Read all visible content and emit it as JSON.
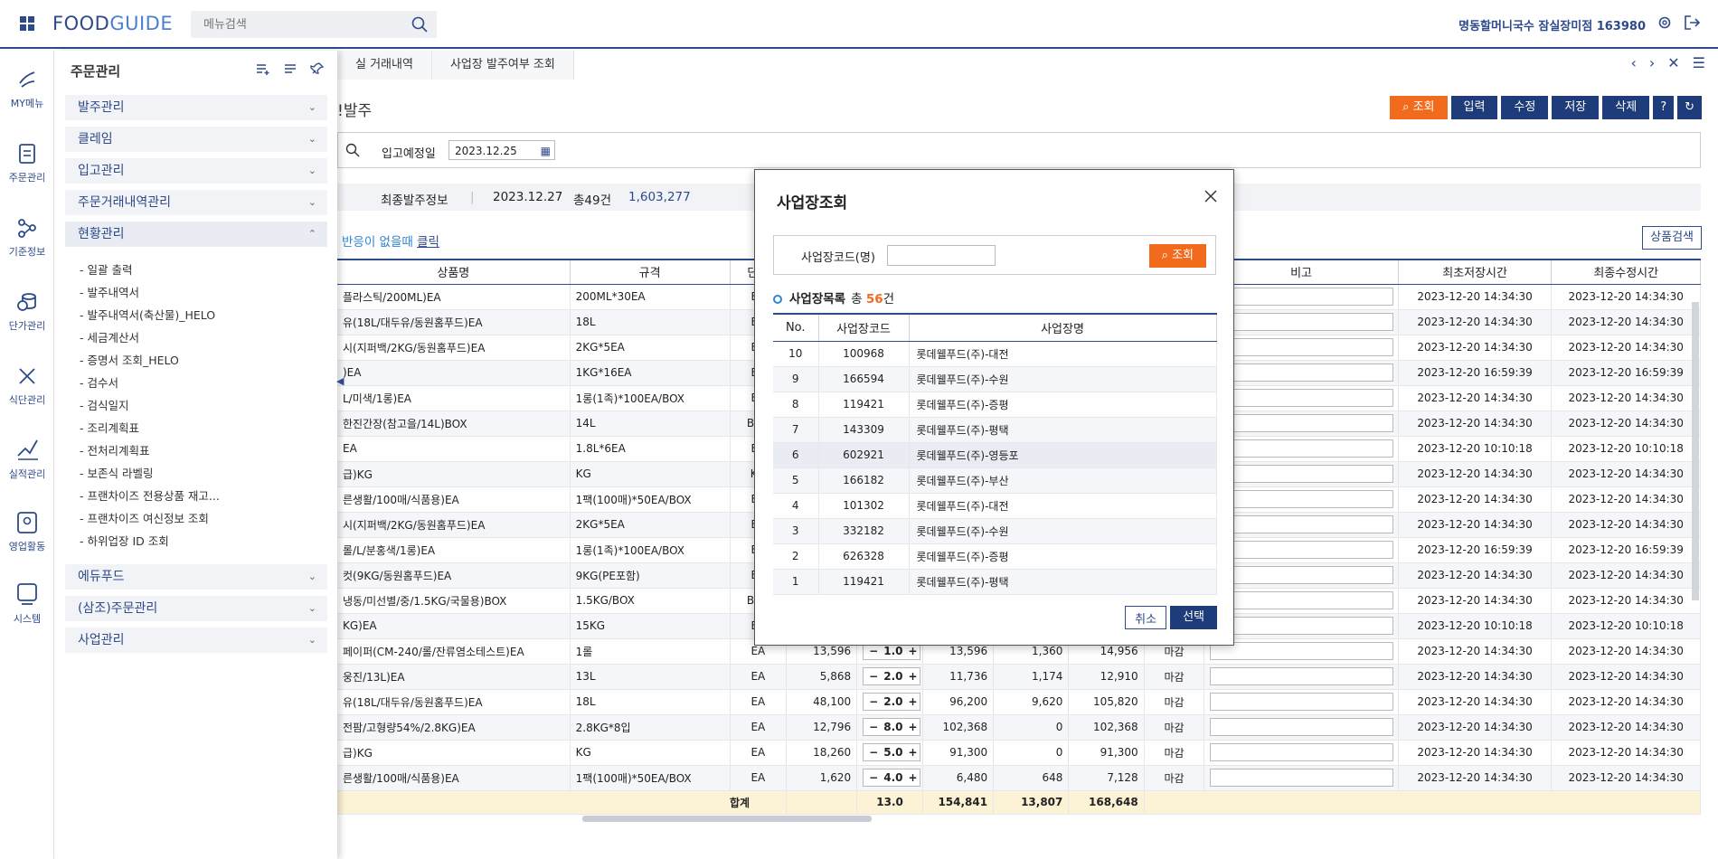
{
  "app": {
    "brand_food": "FOOD",
    "brand_guide": "GUIDE",
    "search_placeholder": "메뉴검색",
    "user": "명동할머니국수 잠실장미점 163980"
  },
  "rail": [
    {
      "label": "MY메뉴",
      "icon": "heart-hands-icon"
    },
    {
      "label": "주문관리",
      "icon": "order-document-icon"
    },
    {
      "label": "기준정보",
      "icon": "share-nodes-icon"
    },
    {
      "label": "단가관리",
      "icon": "coins-icon"
    },
    {
      "label": "식단관리",
      "icon": "utensils-icon"
    },
    {
      "label": "실적관리",
      "icon": "chart-icon"
    },
    {
      "label": "영업활동",
      "icon": "person-badge-icon"
    },
    {
      "label": "시스템",
      "icon": "system-monitor-icon"
    }
  ],
  "sidebar": {
    "title": "주문관리",
    "sections": [
      "발주관리",
      "클레임",
      "입고관리",
      "주문거래내역관리",
      "현황관리"
    ],
    "sub_items": [
      "- 일괄 출력",
      "- 발주내역서",
      "- 발주내역서(축산물)_HELO",
      "- 세금계산서",
      "- 증명서 조회_HELO",
      "- 검수서",
      "- 검식일지",
      "- 조리계획표",
      "- 전처리계획표",
      "- 보존식 라벨링",
      "- 프랜차이즈 전용상품 재고...",
      "- 프랜차이즈 여신정보 조회",
      "- 하위업장 ID 조회"
    ],
    "bottom_sections": [
      "에듀푸드",
      "(삼조)주문관리",
      "사업관리"
    ]
  },
  "tabs": [
    "실 거래내역",
    "사업장 발주여부 조회"
  ],
  "page": {
    "title": "!발주"
  },
  "toolbar": {
    "search": "조회",
    "input": "입력",
    "edit": "수정",
    "save": "저장",
    "delete": "삭제",
    "help": "?"
  },
  "filter": {
    "label": "입고예정일",
    "date": "2023.12.25"
  },
  "info": {
    "label": "최종발주정보",
    "date": "2023.12.27",
    "count": "총49건",
    "amount": "1,603,277"
  },
  "hint": {
    "text": "반응이 없을때 ",
    "link": "클릭"
  },
  "product_search": "상품검색",
  "grid": {
    "headers": [
      "상품명",
      "규격",
      "단위",
      "",
      "",
      "",
      "",
      "",
      "",
      "비고",
      "최초저장시간",
      "최종수정시간"
    ],
    "rows": [
      {
        "name": "플라스틱/200ML)EA",
        "spec": "200ML*30EA",
        "unit": "EA",
        "created": "2023-12-20 14:34:30",
        "modified": "2023-12-20 14:34:30"
      },
      {
        "name": "유(18L/대두유/동원홈푸드)EA",
        "spec": "18L",
        "unit": "EA",
        "created": "2023-12-20 14:34:30",
        "modified": "2023-12-20 14:34:30"
      },
      {
        "name": "시(지퍼백/2KG/동원홈푸드)EA",
        "spec": "2KG*5EA",
        "unit": "EA",
        "created": "2023-12-20 14:34:30",
        "modified": "2023-12-20 14:34:30"
      },
      {
        "name": ")EA",
        "spec": "1KG*16EA",
        "unit": "EA",
        "created": "2023-12-20 16:59:39",
        "modified": "2023-12-20 16:59:39"
      },
      {
        "name": "L/미색/1롱)EA",
        "spec": "1롱(1족)*100EA/BOX",
        "unit": "EA",
        "created": "2023-12-20 14:34:30",
        "modified": "2023-12-20 14:34:30"
      },
      {
        "name": "한진간장(참고을/14L)BOX",
        "spec": "14L",
        "unit": "BOX",
        "created": "2023-12-20 14:34:30",
        "modified": "2023-12-20 14:34:30"
      },
      {
        "name": "EA",
        "spec": "1.8L*6EA",
        "unit": "EA",
        "created": "2023-12-20 10:10:18",
        "modified": "2023-12-20 10:10:18"
      },
      {
        "name": "급)KG",
        "spec": "KG",
        "unit": "KG",
        "created": "2023-12-20 14:34:30",
        "modified": "2023-12-20 14:34:30"
      },
      {
        "name": "른생활/100매/식품용)EA",
        "spec": "1팩(100매)*50EA/BOX",
        "unit": "EA",
        "created": "2023-12-20 14:34:30",
        "modified": "2023-12-20 14:34:30"
      },
      {
        "name": "시(지퍼백/2KG/동원홈푸드)EA",
        "spec": "2KG*5EA",
        "unit": "EA",
        "created": "2023-12-20 14:34:30",
        "modified": "2023-12-20 14:34:30"
      },
      {
        "name": "롤/L/분홍색/1롱)EA",
        "spec": "1롱(1족)*100EA/BOX",
        "unit": "EA",
        "created": "2023-12-20 16:59:39",
        "modified": "2023-12-20 16:59:39"
      },
      {
        "name": "컷(9KG/동원홈푸드)EA",
        "spec": "9KG(PE포함)",
        "unit": "EA",
        "created": "2023-12-20 14:34:30",
        "modified": "2023-12-20 14:34:30"
      },
      {
        "name": "냉동/미선별/중/1.5KG/국물용)BOX",
        "spec": "1.5KG/BOX",
        "unit": "BOX",
        "created": "2023-12-20 14:34:30",
        "modified": "2023-12-20 14:34:30"
      },
      {
        "name": "KG)EA",
        "spec": "15KG",
        "unit": "EA",
        "created": "2023-12-20 10:10:18",
        "modified": "2023-12-20 10:10:18"
      },
      {
        "name": "페이퍼(CM-240/롤/잔류염소테스트)EA",
        "spec": "1롤",
        "unit": "EA",
        "price": "13,596",
        "qty": "1.0",
        "amount": "13,596",
        "vat": "1,360",
        "total": "14,956",
        "status": "마감",
        "created": "2023-12-20 14:34:30",
        "modified": "2023-12-20 14:34:30"
      },
      {
        "name": "웅진/13L)EA",
        "spec": "13L",
        "unit": "EA",
        "price": "5,868",
        "qty": "2.0",
        "amount": "11,736",
        "vat": "1,174",
        "total": "12,910",
        "status": "마감",
        "created": "2023-12-20 14:34:30",
        "modified": "2023-12-20 14:34:30"
      },
      {
        "name": "유(18L/대두유/동원홈푸드)EA",
        "spec": "18L",
        "unit": "EA",
        "price": "48,100",
        "qty": "2.0",
        "amount": "96,200",
        "vat": "9,620",
        "total": "105,820",
        "status": "마감",
        "created": "2023-12-20 14:34:30",
        "modified": "2023-12-20 14:34:30"
      },
      {
        "name": "전팜/고형량54%/2.8KG)EA",
        "spec": "2.8KG*8입",
        "unit": "EA",
        "price": "12,796",
        "qty": "8.0",
        "amount": "102,368",
        "vat": "0",
        "total": "102,368",
        "status": "마감",
        "created": "2023-12-20 14:34:30",
        "modified": "2023-12-20 14:34:30"
      },
      {
        "name": "급)KG",
        "spec": "KG",
        "unit": "EA",
        "price": "18,260",
        "qty": "5.0",
        "amount": "91,300",
        "vat": "0",
        "total": "91,300",
        "status": "마감",
        "created": "2023-12-20 14:34:30",
        "modified": "2023-12-20 14:34:30"
      },
      {
        "name": "른생활/100매/식품용)EA",
        "spec": "1팩(100매)*50EA/BOX",
        "unit": "EA",
        "price": "1,620",
        "qty": "4.0",
        "amount": "6,480",
        "vat": "648",
        "total": "7,128",
        "status": "마감",
        "created": "2023-12-20 14:34:30",
        "modified": "2023-12-20 14:34:30"
      }
    ],
    "sum": {
      "label": "합계",
      "qty": "13.0",
      "amount": "154,841",
      "vat": "13,807",
      "total": "168,648"
    }
  },
  "modal": {
    "title": "사업장조회",
    "search_label": "사업장코드(명)",
    "search_button": "조회",
    "list_title": "사업장목록",
    "count_prefix": "총",
    "count": "56",
    "count_suffix": "건",
    "headers": [
      "No.",
      "사업장코드",
      "사업장명"
    ],
    "rows": [
      {
        "no": "10",
        "code": "100968",
        "name": "롯데웰푸드(주)-대전"
      },
      {
        "no": "9",
        "code": "166594",
        "name": "롯데웰푸드(주)-수원"
      },
      {
        "no": "8",
        "code": "119421",
        "name": "롯데웰푸드(주)-증평"
      },
      {
        "no": "7",
        "code": "143309",
        "name": "롯데웰푸드(주)-평택"
      },
      {
        "no": "6",
        "code": "602921",
        "name": "롯데웰푸드(주)-영등포"
      },
      {
        "no": "5",
        "code": "166182",
        "name": "롯데웰푸드(주)-부산"
      },
      {
        "no": "4",
        "code": "101302",
        "name": "롯데웰푸드(주)-대전"
      },
      {
        "no": "3",
        "code": "332182",
        "name": "롯데웰푸드(주)-수원"
      },
      {
        "no": "2",
        "code": "626328",
        "name": "롯데웰푸드(주)-증평"
      },
      {
        "no": "1",
        "code": "119421",
        "name": "롯데웰푸드(주)-평택"
      }
    ],
    "cancel": "취소",
    "select": "선택"
  }
}
